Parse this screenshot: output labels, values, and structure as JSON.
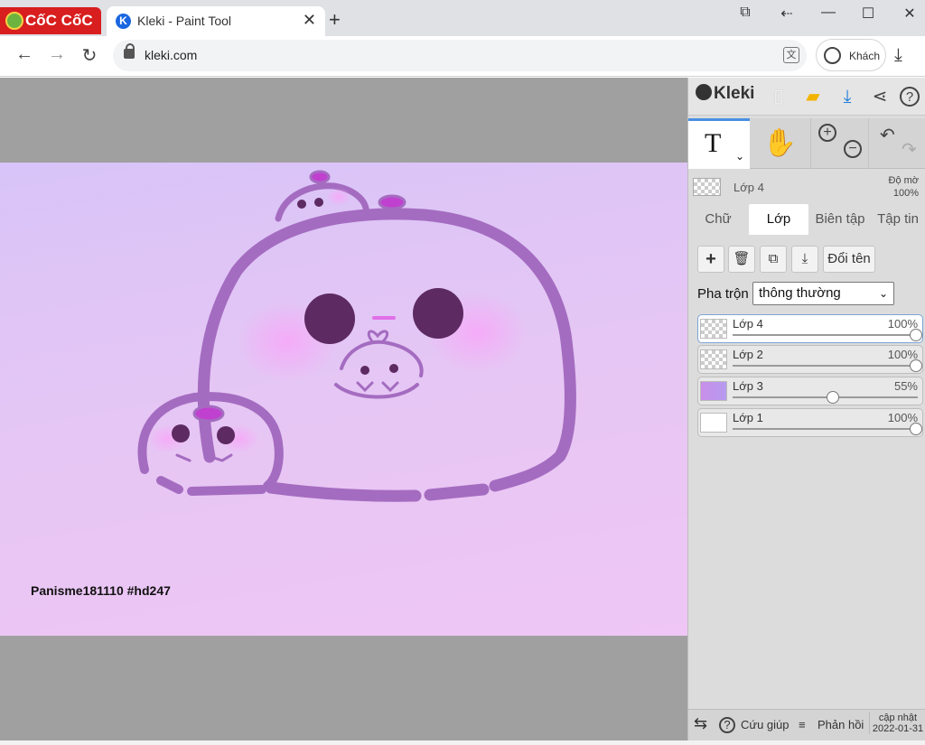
{
  "browser": {
    "brand": "CốC CốC",
    "tab_title": "Kleki - Paint Tool",
    "tab_close": "✕",
    "new_tab": "+",
    "url": "kleki.com",
    "guest_label": "Khách",
    "icons": [
      "back-arrow-icon",
      "forward-arrow-icon",
      "reload-icon",
      "lock-icon",
      "translate-icon",
      "profile-icon",
      "download-icon",
      "cast-icon",
      "tab-search-icon",
      "minimize-icon",
      "maximize-icon",
      "close-icon"
    ]
  },
  "canvas": {
    "signature": "Panisme181110 #hd247",
    "colors": {
      "line": "#a46cc0",
      "eye": "#5d2a62",
      "blush": "#f6aaf8",
      "bow": "#c040d0"
    }
  },
  "panel": {
    "logo": "Kleki",
    "current_layer": {
      "name": "Lớp 4",
      "opacity_label": "Độ mờ",
      "opacity_value": "100%"
    },
    "tabs": [
      "Chữ",
      "Lớp",
      "Biên tập",
      "Tập tin"
    ],
    "active_tab": "Lớp",
    "rename_label": "Đổi tên",
    "blend_label": "Pha trộn",
    "blend_value": "thông thường",
    "layers": [
      {
        "name": "Lớp 4",
        "opacity": "100%",
        "value": 1.0,
        "selected": true
      },
      {
        "name": "Lớp 2",
        "opacity": "100%",
        "value": 1.0,
        "selected": false
      },
      {
        "name": "Lớp 3",
        "opacity": "55%",
        "value": 0.55,
        "selected": false
      },
      {
        "name": "Lớp 1",
        "opacity": "100%",
        "value": 1.0,
        "selected": false
      }
    ],
    "footer": {
      "help": "Cứu giúp",
      "feedback": "Phản hồi",
      "update_label": "cập nhật",
      "update_date": "2022-01-31"
    }
  }
}
